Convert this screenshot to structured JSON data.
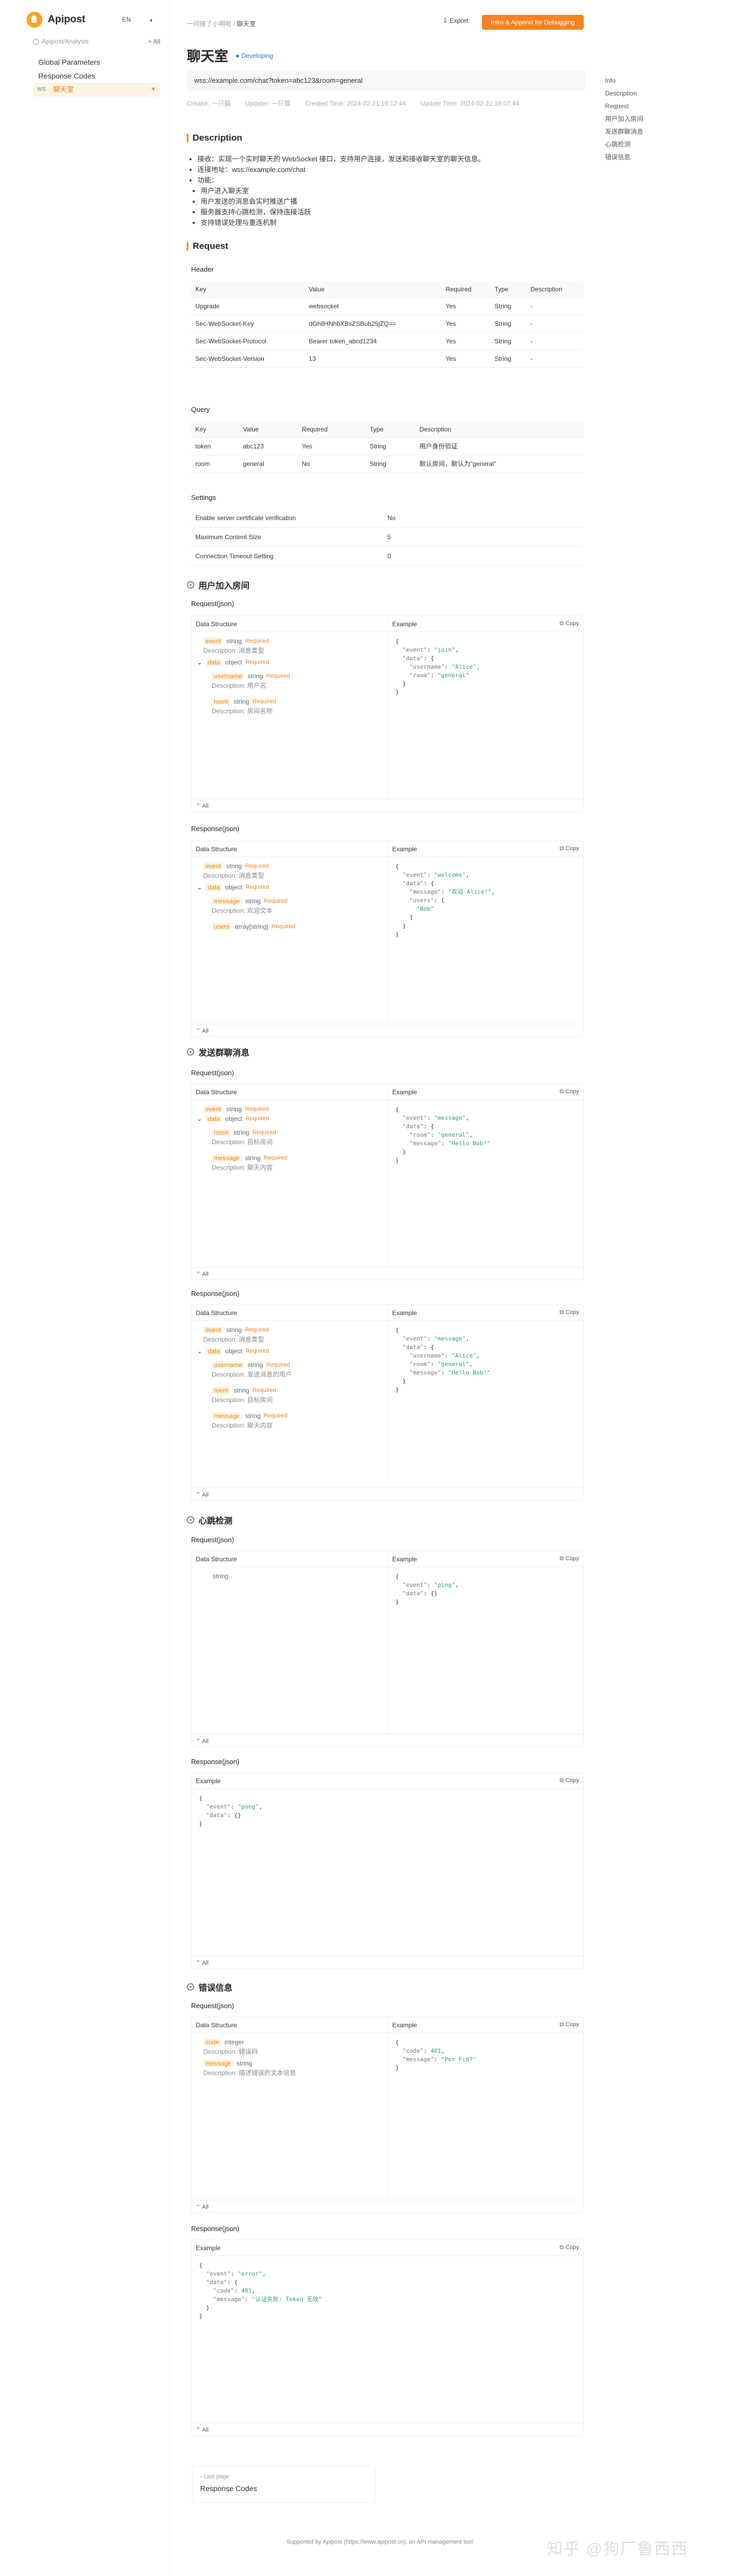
{
  "brand": "Apipost",
  "lang": "EN",
  "search_placeholder": "Apipost/Analysis",
  "plus_label": "+ All",
  "nav": {
    "global": "Global Parameters",
    "codes": "Response Codes",
    "ws_method": "WS",
    "ws_label": "聊天室"
  },
  "breadcrumb": {
    "parent": "一问接了小明啦",
    "current": "聊天室"
  },
  "toolbar": {
    "export": "Export",
    "open": "Intro & Append for Debugging"
  },
  "title": "聊天室",
  "status": "Developing",
  "url": "wss://example.com/chat?token=abc123&room=general",
  "meta": {
    "creator": "Creator: 一只猫",
    "updater": "Updater: 一只猫",
    "created": "Created Time: 2024-02-21 16:12:44",
    "updated": "Update Time: 2024-02-21 18:07:44"
  },
  "description": {
    "heading": "Description",
    "lines": [
      "接收：实现一个实时聊天的 WebSocket 接口，支持用户连接，发送和接收聊天室的聊天信息。",
      "连接地址：wss://example.com/chat",
      "功能："
    ],
    "features": [
      "用户进入聊天室",
      "用户发送的消息会实时推送广播",
      "服务器支持心跳检测，保持连接活跃",
      "支持错误处理与重连机制"
    ]
  },
  "request": {
    "heading": "Request",
    "header_label": "Header",
    "query_label": "Query",
    "columns": [
      "Key",
      "Value",
      "Required",
      "Type",
      "Description"
    ],
    "headers": [
      [
        "Upgrade",
        "websocket",
        "Yes",
        "String",
        "-"
      ],
      [
        "Sec-WebSocket-Key",
        "dGhlIHNhbXBsZSBub25jZQ==",
        "Yes",
        "String",
        "-"
      ],
      [
        "Sec-WebSocket-Protocol",
        "Bearer token_abcd1234",
        "Yes",
        "String",
        "-"
      ],
      [
        "Sec-WebSocket-Version",
        "13",
        "Yes",
        "String",
        "-"
      ]
    ],
    "query": [
      [
        "token",
        "abc123",
        "Yes",
        "String",
        "用户身份验证"
      ],
      [
        "room",
        "general",
        "No",
        "String",
        "默认房间，默认为\"general\""
      ]
    ],
    "settings_label": "Settings",
    "settings": [
      [
        "Enable server certificate verification",
        "No"
      ],
      [
        "Maximum Content Size",
        "5"
      ],
      [
        "Connection Timeout Setting",
        "0"
      ]
    ]
  },
  "labels": {
    "req_json": "Request(json)",
    "res_json": "Response(json)",
    "ds": "Data Structure",
    "ex": "Example",
    "copy": "Copy",
    "all": "All",
    "desc": "Description:",
    "required": "Required"
  },
  "messages": [
    {
      "title": "用户加入房间"
    },
    {
      "title": "发送群聊消息"
    },
    {
      "title": "心跳检测"
    },
    {
      "title": "错误信息"
    }
  ],
  "toc": [
    "Info",
    "Description",
    "Request",
    "用户加入房间",
    "发送群聊消息",
    "心跳检测",
    "错误信息"
  ],
  "last_page": {
    "label": "Last page",
    "target": "Response Codes"
  },
  "footer": "Supported by Apipost (https://www.apipost.cn), an API management tool",
  "watermark": "知乎 @狗厂鲁西西"
}
